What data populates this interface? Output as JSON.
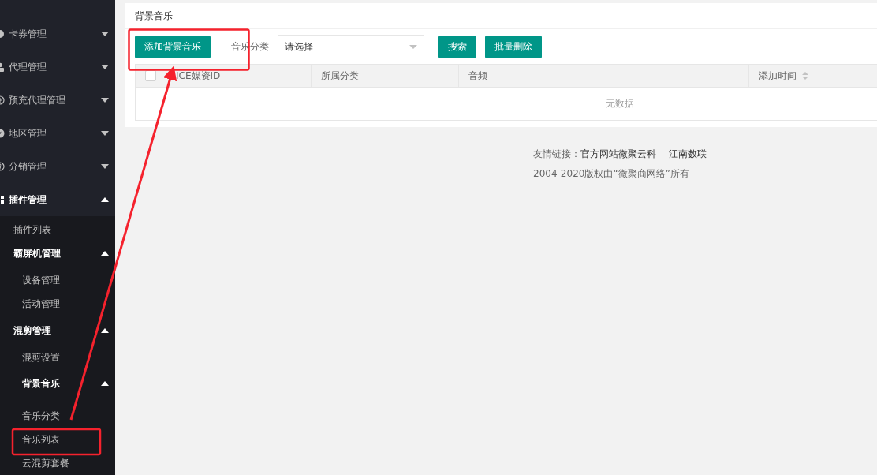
{
  "sidebar": {
    "items": [
      {
        "label": "卡券管理",
        "expanded": false
      },
      {
        "label": "代理管理",
        "expanded": false
      },
      {
        "label": "预充代理管理",
        "expanded": false
      },
      {
        "label": "地区管理",
        "expanded": false
      },
      {
        "label": "分销管理",
        "expanded": false
      },
      {
        "label": "插件管理",
        "expanded": true,
        "children": [
          {
            "label": "插件列表"
          },
          {
            "label": "霸屏机管理",
            "expanded": true,
            "children": [
              {
                "label": "设备管理"
              },
              {
                "label": "活动管理"
              }
            ]
          },
          {
            "label": "混剪管理",
            "expanded": true,
            "children": [
              {
                "label": "混剪设置"
              },
              {
                "label": "背景音乐",
                "expanded": true,
                "children": [
                  {
                    "label": "音乐分类"
                  },
                  {
                    "label": "音乐列表"
                  },
                  {
                    "label": "云混剪套餐"
                  }
                ]
              }
            ]
          }
        ]
      }
    ]
  },
  "panel": {
    "title": "背景音乐",
    "add_button": "添加背景音乐",
    "filter_label": "音乐分类",
    "select": {
      "value": "请选择"
    },
    "search_button": "搜索",
    "delete_button": "批量删除",
    "table": {
      "select_all": {
        "checked": false
      },
      "columns": [
        {
          "label": "ICE媒资ID",
          "sortable": false
        },
        {
          "label": "所属分类",
          "sortable": false
        },
        {
          "label": "音频",
          "sortable": false
        },
        {
          "label": "添加时间",
          "sortable": true
        }
      ],
      "empty_text": "无数据"
    }
  },
  "footer": {
    "links_label": "友情链接：",
    "links": [
      "官方网站微聚云科",
      "江南数联"
    ],
    "copyright": "2004-2020版权由“微聚商网络”所有"
  }
}
